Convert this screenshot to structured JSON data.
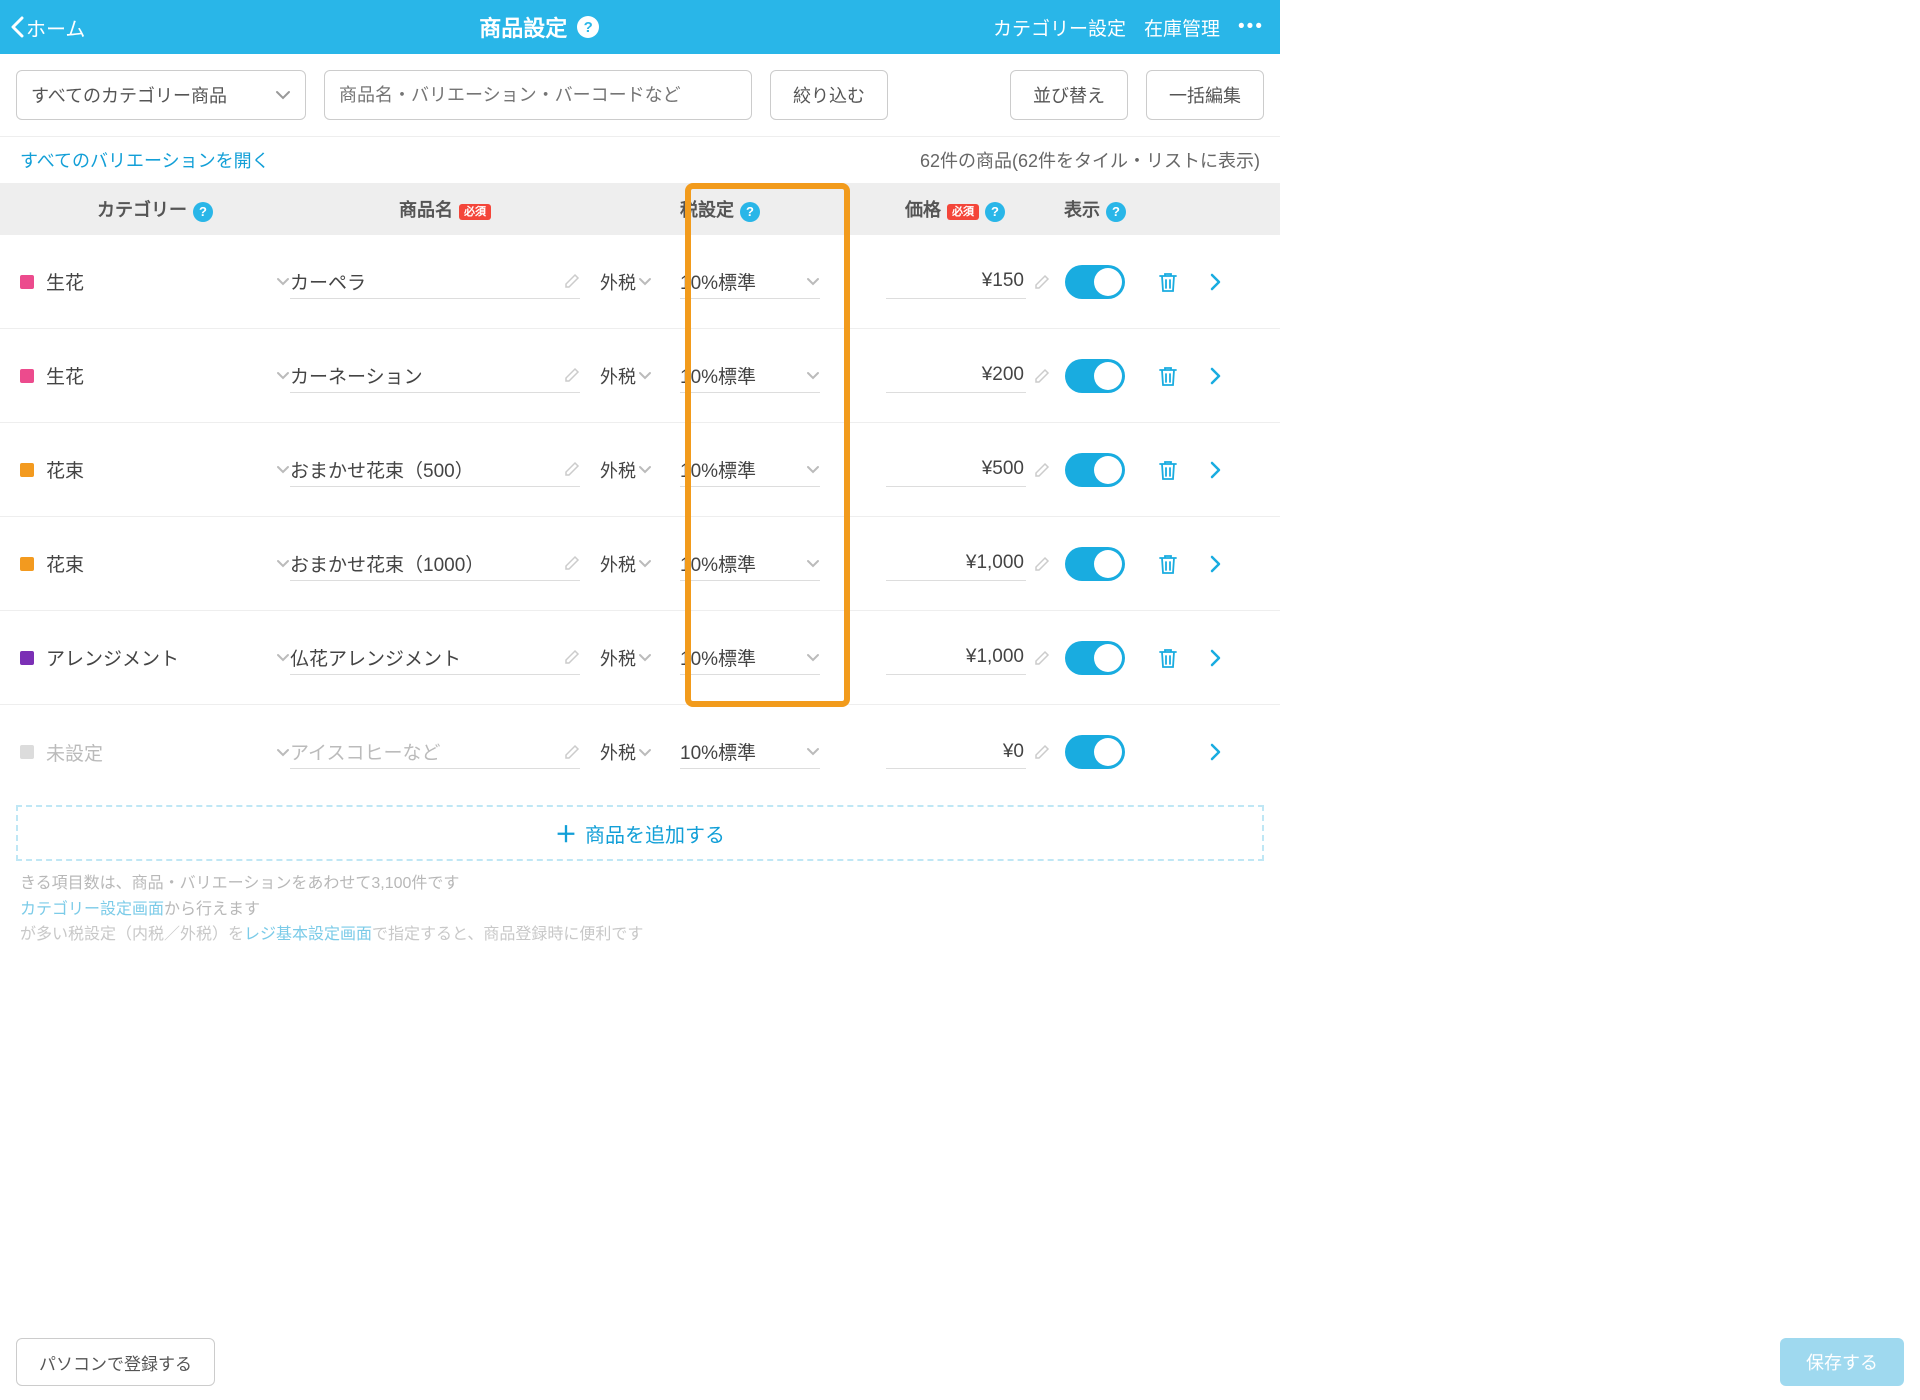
{
  "topbar": {
    "back_label": "ホーム",
    "title": "商品設定",
    "nav_category": "カテゴリー設定",
    "nav_stock": "在庫管理"
  },
  "toolbar": {
    "category_filter": "すべてのカテゴリー商品",
    "search_placeholder": "商品名・バリエーション・バーコードなど",
    "filter_btn": "絞り込む",
    "sort_btn": "並び替え",
    "bulk_btn": "一括編集"
  },
  "subbar": {
    "expand_link": "すべてのバリエーションを開く",
    "count_text": "62件の商品(62件をタイル・リストに表示)"
  },
  "headers": {
    "category": "カテゴリー",
    "name": "商品名",
    "required": "必須",
    "tax": "税設定",
    "price": "価格",
    "display": "表示"
  },
  "tax_mode_label": "外税",
  "rows": [
    {
      "swatch": "#ec4b8d",
      "category": "生花",
      "name": "カーペラ",
      "tax": "10%標準",
      "price": "¥150"
    },
    {
      "swatch": "#ec4b8d",
      "category": "生花",
      "name": "カーネーション",
      "tax": "10%標準",
      "price": "¥200"
    },
    {
      "swatch": "#f39a1f",
      "category": "花束",
      "name": "おまかせ花束（500）",
      "tax": "10%標準",
      "price": "¥500"
    },
    {
      "swatch": "#f39a1f",
      "category": "花束",
      "name": "おまかせ花束（1000）",
      "tax": "10%標準",
      "price": "¥1,000"
    },
    {
      "swatch": "#7b2fb5",
      "category": "アレンジメント",
      "name": "仏花アレンジメント",
      "tax": "10%標準",
      "price": "¥1,000"
    },
    {
      "swatch": "#dcdcdc",
      "category": "未設定",
      "name_placeholder": "アイスコヒーなど",
      "tax": "10%標準",
      "price": "¥0",
      "unset": true,
      "no_trash": true
    }
  ],
  "add_row": "商品を追加する",
  "footer": {
    "line1a": "きる項目数は、商品・バリエーションをあわせて3,100件です",
    "line2a": "カテゴリー設定画面",
    "line2b": "から行えます",
    "line3a": "が多い税設定（内税／外税）を",
    "line3b": "レジ基本設定画面",
    "line3c": "で指定すると、商品登録時に便利です",
    "pc_btn": "パソコンで登録する",
    "save_btn": "保存する"
  }
}
